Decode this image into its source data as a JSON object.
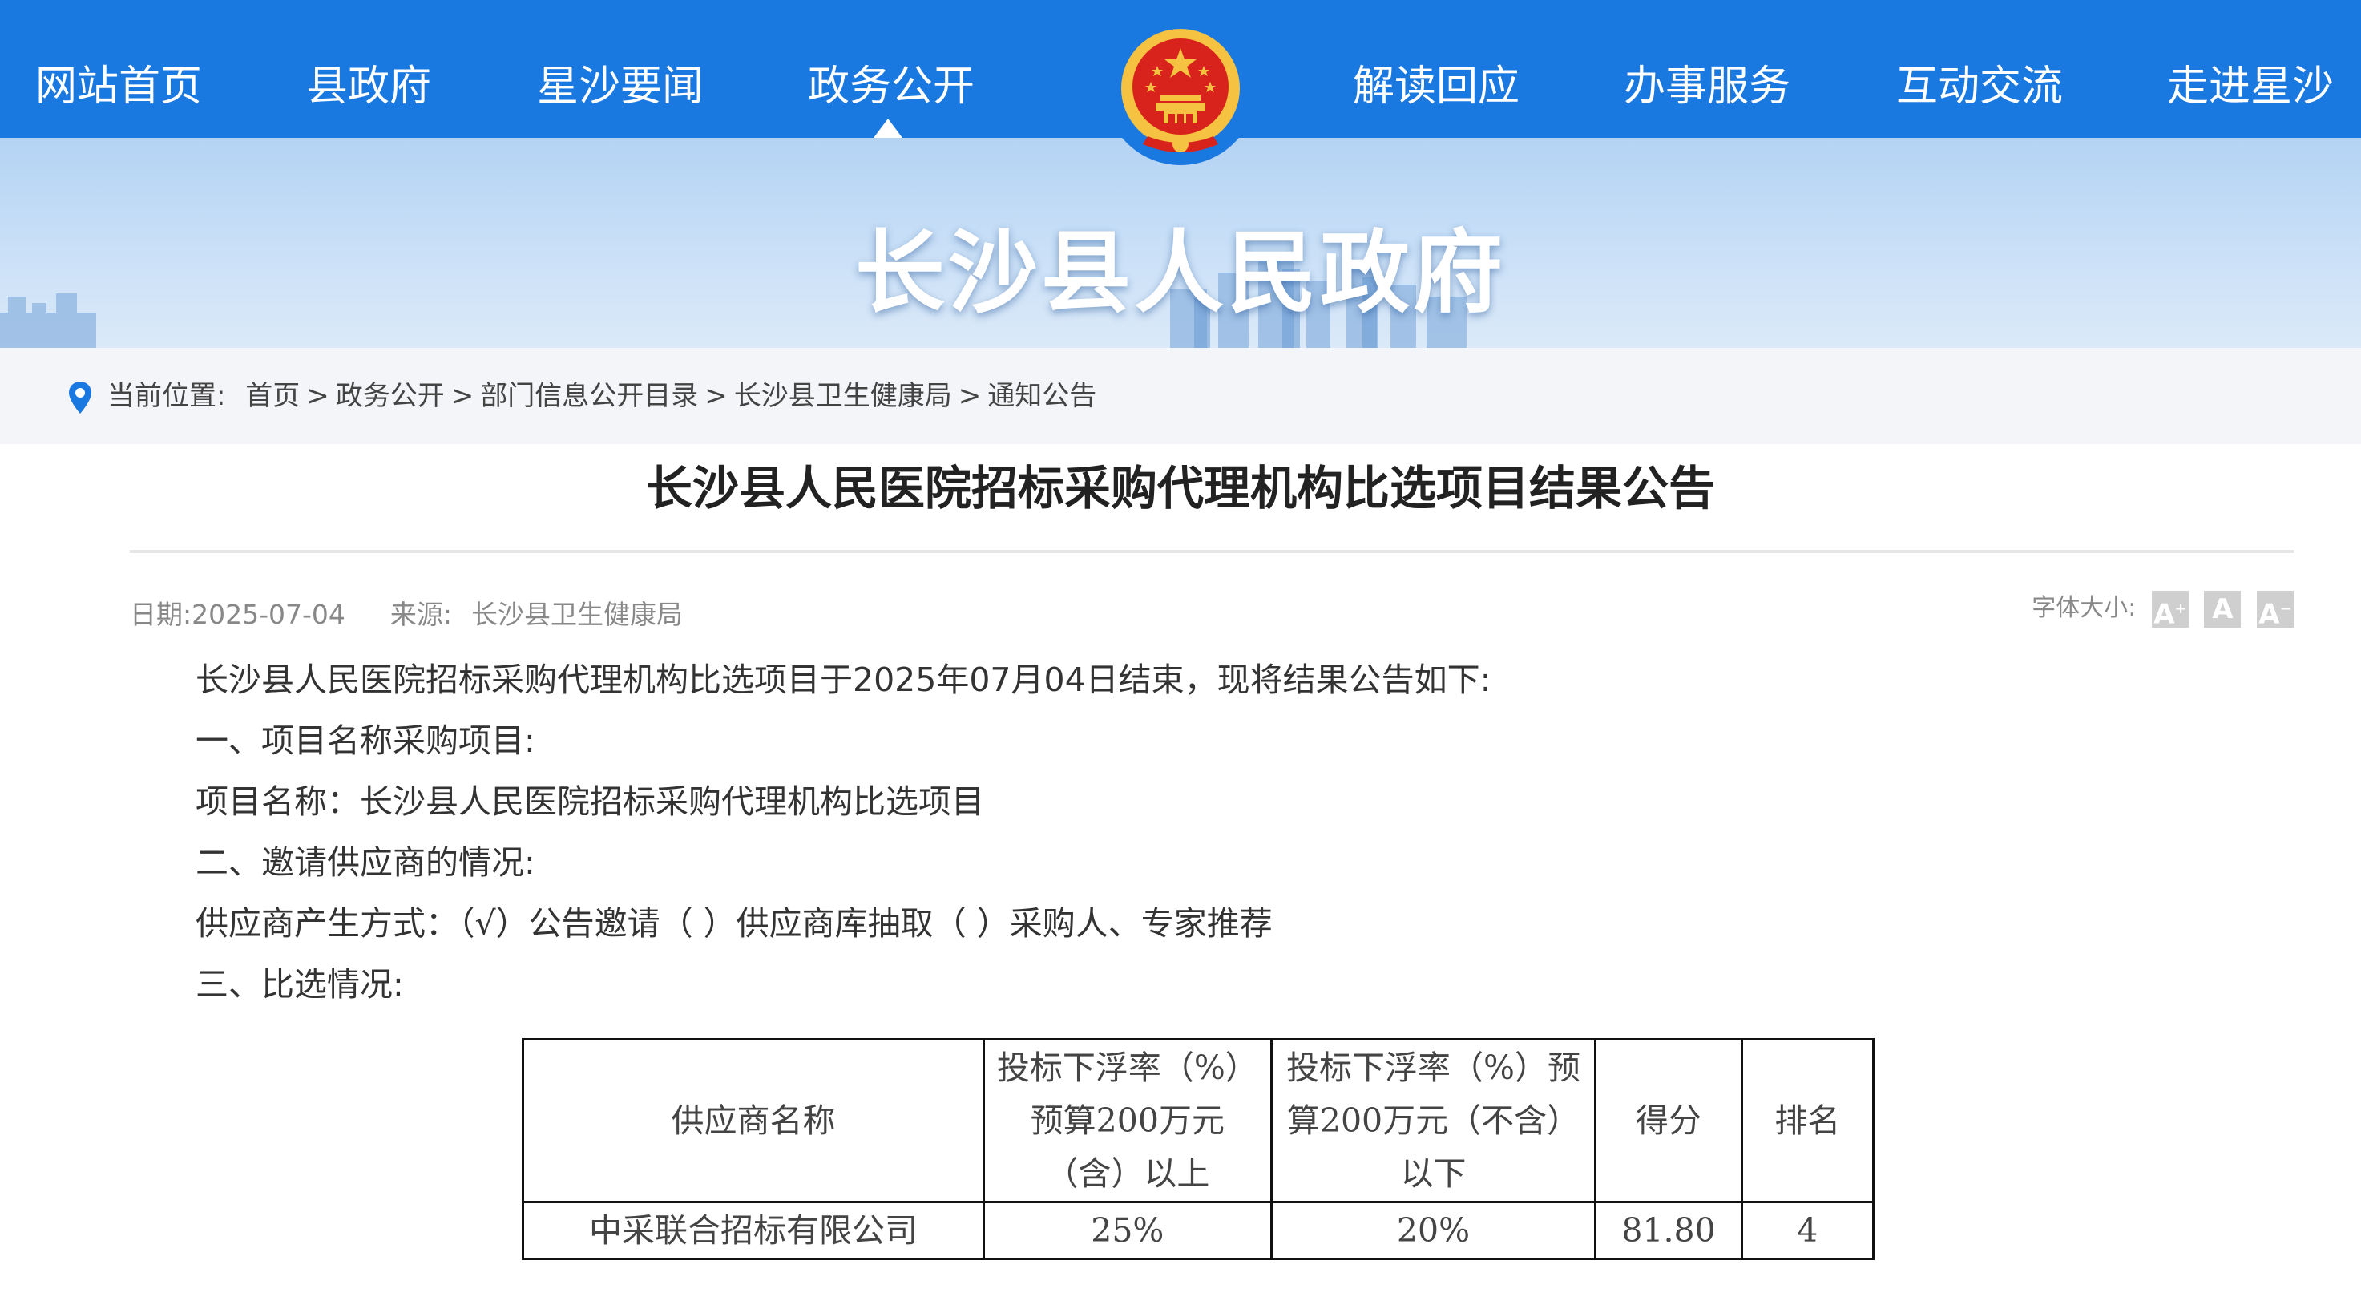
{
  "nav": {
    "items": [
      "网站首页",
      "县政府",
      "星沙要闻",
      "政务公开",
      "解读回应",
      "办事服务",
      "互动交流",
      "走进星沙"
    ],
    "active": "政务公开"
  },
  "site_title": "长沙县人民政府",
  "breadcrumb": {
    "prefix": "当前位置:",
    "items": [
      "首页",
      "政务公开",
      "部门信息公开目录",
      "长沙县卫生健康局",
      "通知公告"
    ],
    "separator": ">"
  },
  "article": {
    "title": "长沙县人民医院招标采购代理机构比选项目结果公告",
    "date_label": "日期:",
    "date": "2025-07-04",
    "source_label": "来源:",
    "source": "长沙县卫生健康局",
    "font_size_label": "字体大小:",
    "font_buttons": [
      "A",
      "A",
      "A"
    ],
    "paragraphs": [
      "长沙县人民医院招标采购代理机构比选项目于2025年07月04日结束，现将结果公告如下:",
      "一、项目名称采购项目:",
      "项目名称：长沙县人民医院招标采购代理机构比选项目",
      "二、邀请供应商的情况:",
      "供应商产生方式：（√）公告邀请（ ）供应商库抽取（ ）采购人、专家推荐",
      "三、比选情况:"
    ]
  },
  "table": {
    "headers": [
      "供应商名称",
      "投标下浮率（%）预算200万元（含）以上",
      "投标下浮率（%）预算200万元（不含）以下",
      "得分",
      "排名"
    ],
    "rows": [
      [
        "中采联合招标有限公司",
        "25%",
        "20%",
        "81.80",
        "4"
      ]
    ]
  },
  "colors": {
    "nav_bg": "#1a78e1",
    "breadcrumb_bg": "#f3f5f8",
    "pin": "#1a78e1",
    "emblem_red": "#d7231c",
    "emblem_gold": "#f5c242"
  },
  "icons": {
    "location": "location-pin-icon",
    "emblem": "national-emblem-icon"
  }
}
